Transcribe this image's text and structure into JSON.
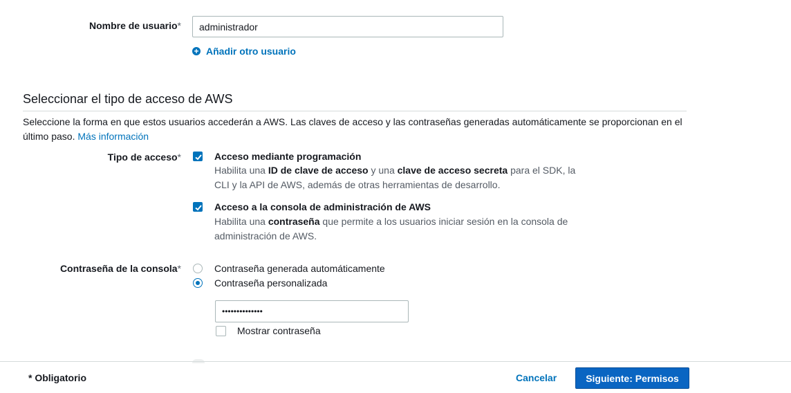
{
  "username": {
    "label": "Nombre de usuario",
    "required_mark": "*",
    "value": "administrador",
    "add_user_label": "Añadir otro usuario"
  },
  "access": {
    "section_title": "Seleccionar el tipo de acceso de AWS",
    "description": "Seleccione la forma en que estos usuarios accederán a AWS. Las claves de acceso y las contraseñas generadas automáticamente se proporcionan en el último paso.",
    "more_info_link": "Más información",
    "type_label": "Tipo de acceso",
    "required_mark": "*",
    "options": [
      {
        "title": "Acceso mediante programación",
        "checked": true,
        "desc_1": "Habilita una ",
        "desc_bold_1": "ID de clave de acceso",
        "desc_2": " y una ",
        "desc_bold_2": "clave de acceso secreta",
        "desc_3": " para el SDK, la CLI y la API de AWS, además de otras herramientas de desarrollo."
      },
      {
        "title": "Acceso a la consola de administración de AWS",
        "checked": true,
        "desc_1": "Habilita una ",
        "desc_bold_1": "contraseña",
        "desc_2": " que permite a los usuarios iniciar sesión en la consola de administración de AWS."
      }
    ]
  },
  "console_password": {
    "label": "Contraseña de la consola",
    "required_mark": "*",
    "options": [
      {
        "label": "Contraseña generada automáticamente",
        "selected": false
      },
      {
        "label": "Contraseña personalizada",
        "selected": true
      }
    ],
    "password_value": "••••••••••••••",
    "show_password_label": "Mostrar contraseña",
    "show_password_checked": false
  },
  "footer": {
    "required_note": "* Obligatorio",
    "cancel_label": "Cancelar",
    "next_label": "Siguiente: Permisos"
  },
  "colors": {
    "accent": "#0073bb",
    "primary_button": "#0a65c2"
  }
}
